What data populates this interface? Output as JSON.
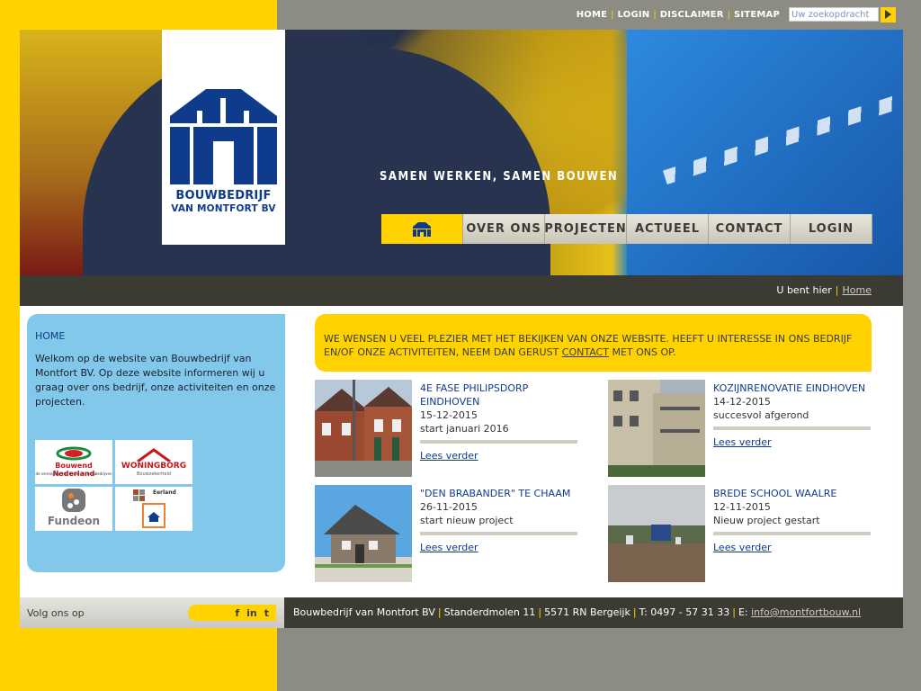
{
  "topnav": {
    "links": [
      "HOME",
      "LOGIN",
      "DISCLAIMER",
      "SITEMAP"
    ],
    "search_placeholder": "Uw zoekopdracht"
  },
  "banner": {
    "logo_line1": "BOUWBEDRIJF",
    "logo_line2": "VAN MONTFORT BV",
    "slogan": "SAMEN WERKEN, SAMEN BOUWEN"
  },
  "mainnav": {
    "items": [
      "OVER ONS",
      "PROJECTEN",
      "ACTUEEL",
      "CONTACT",
      "LOGIN"
    ]
  },
  "breadcrumb": {
    "label": "U bent hier",
    "current": "Home"
  },
  "sidebar": {
    "heading": "HOME",
    "intro": "Welkom op de website van Bouwbedrijf van Montfort BV. Op deze website informeren wij u graag over ons bedrijf, onze activiteiten en onze projecten.",
    "logos": [
      {
        "name": "Bouwend Nederland",
        "sub": "de vereniging van bouw- en infrabedrijven"
      },
      {
        "name": "WONINGBORG",
        "sub": "Bouwzekerheid"
      },
      {
        "name": "Fundeon"
      },
      {
        "name": "Eerland"
      }
    ]
  },
  "welcome": {
    "text_before": "WE WENSEN U VEEL PLEZIER MET HET BEKIJKEN VAN ONZE WEBSITE. HEEFT U INTERESSE IN ONS BEDRIJF EN/OF ONZE ACTIVITEITEN, NEEM DAN GERUST ",
    "link": "CONTACT",
    "text_after": " MET ONS OP."
  },
  "news": [
    {
      "title": "4E FASE PHILIPSDORP EINDHOVEN",
      "date": "15-12-2015",
      "subtitle": "start januari 2016",
      "more": "Lees verder"
    },
    {
      "title": "KOZIJNRENOVATIE EINDHOVEN",
      "date": "14-12-2015",
      "subtitle": "succesvol afgerond",
      "more": "Lees verder"
    },
    {
      "title": "\"DEN BRABANDER\" TE CHAAM",
      "date": "26-11-2015",
      "subtitle": "start nieuw project",
      "more": "Lees verder"
    },
    {
      "title": "BREDE SCHOOL WAALRE",
      "date": "12-11-2015",
      "subtitle": "Nieuw project gestart",
      "more": "Lees verder"
    }
  ],
  "footer": {
    "follow": "Volg ons op",
    "social": [
      "f",
      "in",
      "t"
    ],
    "company": "Bouwbedrijf van Montfort BV",
    "street": "Standerdmolen 11",
    "city": "5571 RN Bergeijk",
    "phone": "T: 0497 - 57 31 33",
    "email_label": "E:",
    "email": "info@montfortbouw.nl"
  },
  "colors": {
    "yellow": "#ffd200",
    "dark": "#3b3b33",
    "blue": "#0f3b8c",
    "sky": "#82c8ea"
  }
}
